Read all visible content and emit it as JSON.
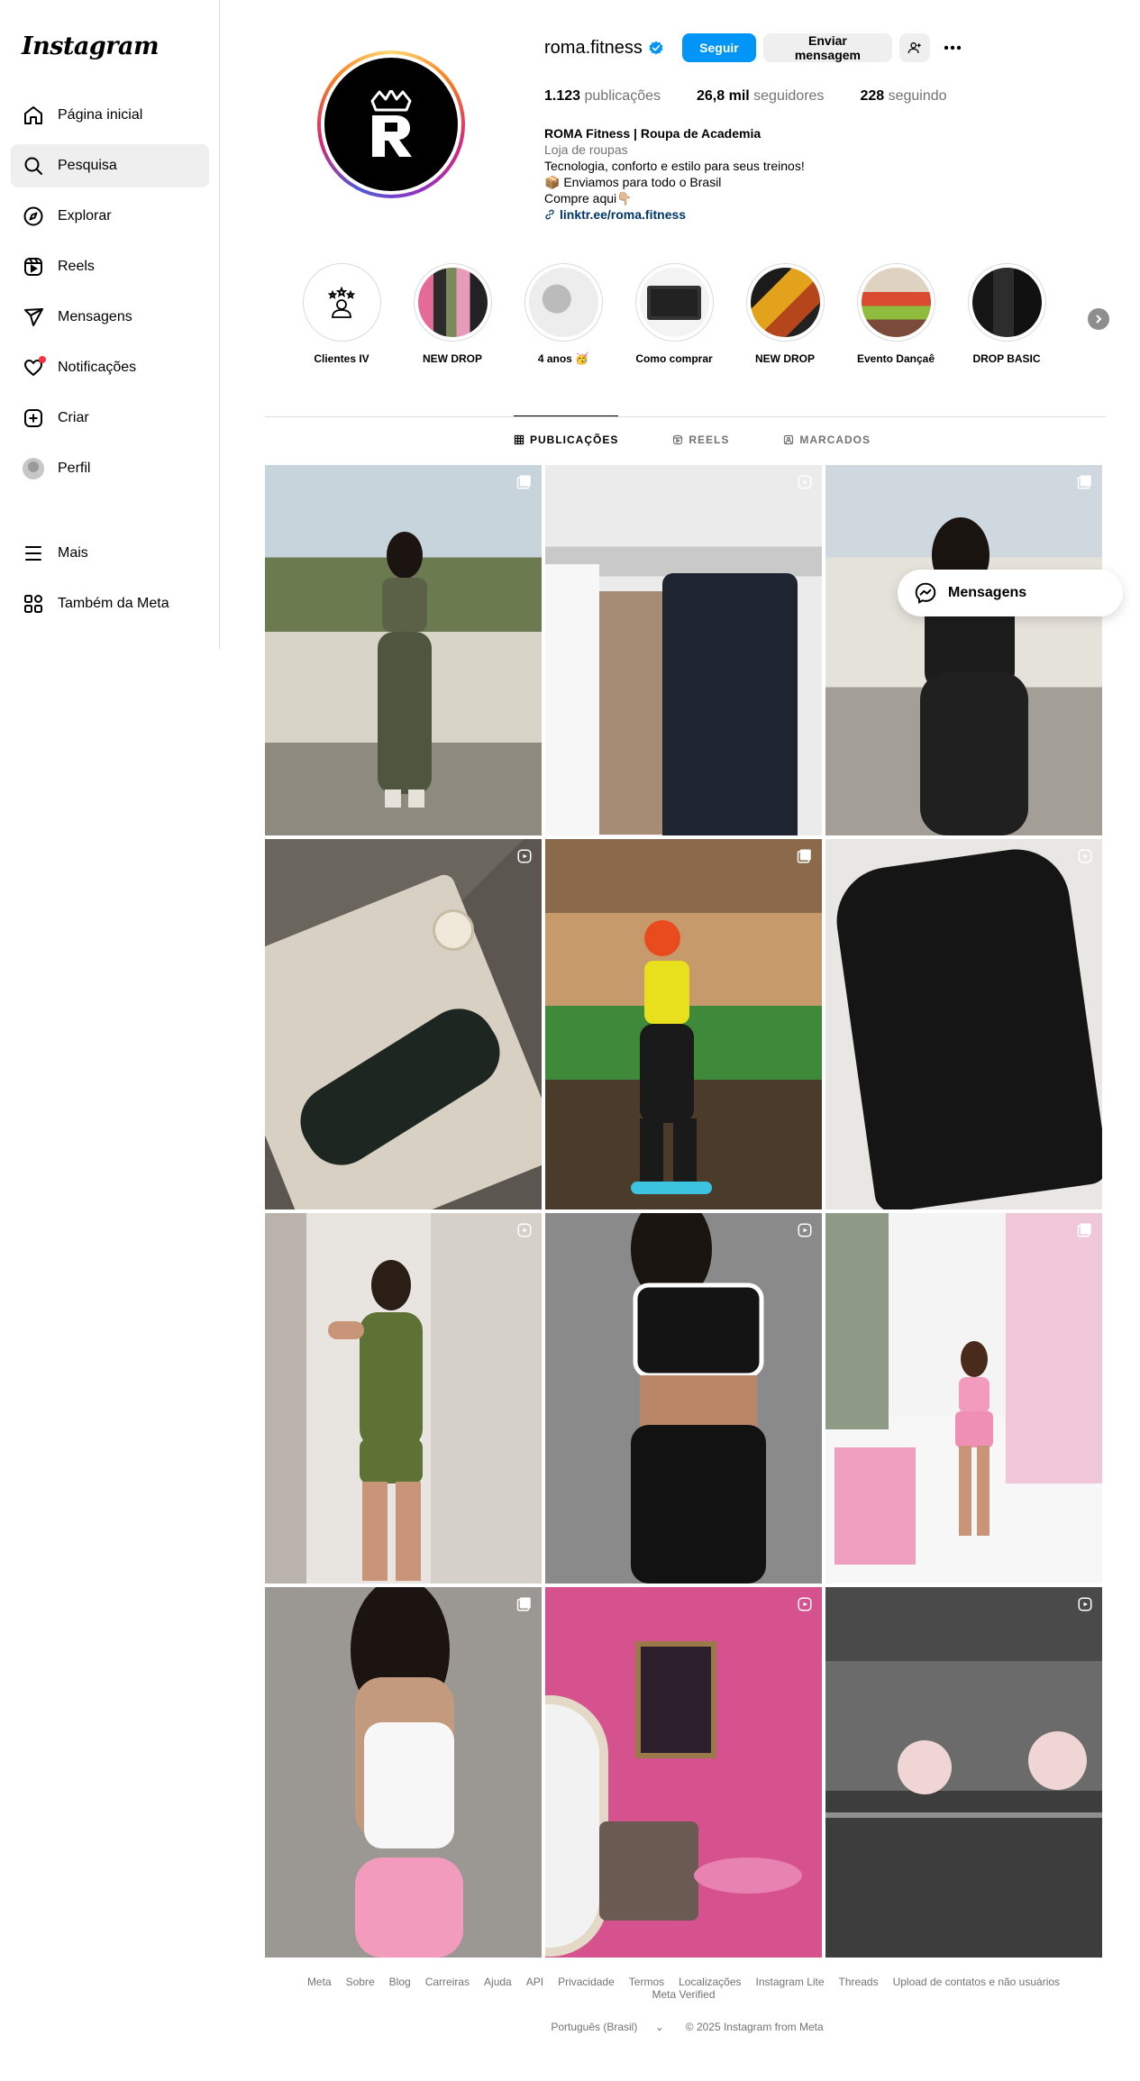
{
  "sidebar": {
    "logo": "Instagram",
    "items": [
      {
        "label": "Página inicial",
        "icon": "home-icon"
      },
      {
        "label": "Pesquisa",
        "icon": "search-icon"
      },
      {
        "label": "Explorar",
        "icon": "compass-icon"
      },
      {
        "label": "Reels",
        "icon": "reels-icon"
      },
      {
        "label": "Mensagens",
        "icon": "send-icon"
      },
      {
        "label": "Notificações",
        "icon": "heart-icon"
      },
      {
        "label": "Criar",
        "icon": "plus-square-icon"
      },
      {
        "label": "Perfil",
        "icon": "avatar"
      }
    ],
    "bottom": [
      {
        "label": "Mais",
        "icon": "menu-icon"
      },
      {
        "label": "Também da Meta",
        "icon": "meta-apps-icon"
      }
    ]
  },
  "profile": {
    "username": "roma.fitness",
    "follow_label": "Seguir",
    "message_label": "Enviar mensagem",
    "stats": {
      "posts_count": "1.123",
      "posts_label": "publicações",
      "followers_count": "26,8 mil",
      "followers_label": "seguidores",
      "following_count": "228",
      "following_label": "seguindo"
    },
    "bio": {
      "name": "ROMA Fitness | Roupa de Academia",
      "category": "Loja de roupas",
      "line1": "Tecnologia, conforto e estilo para seus treinos!",
      "line2": "📦 Enviamos para todo o Brasil",
      "line3": "Compre aqui👇🏼",
      "link": "linktr.ee/roma.fitness"
    }
  },
  "highlights": [
    {
      "label": "Clientes IV"
    },
    {
      "label": "NEW DROP"
    },
    {
      "label": "4 anos 🥳"
    },
    {
      "label": "Como comprar"
    },
    {
      "label": "NEW DROP"
    },
    {
      "label": "Evento Dançaê"
    },
    {
      "label": "DROP BASIC"
    }
  ],
  "tabs": [
    {
      "label": "PUBLICAÇÕES",
      "icon": "grid-icon",
      "active": true
    },
    {
      "label": "REELS",
      "icon": "reels-icon",
      "active": false
    },
    {
      "label": "MARCADOS",
      "icon": "tagged-icon",
      "active": false
    }
  ],
  "posts": [
    {
      "type": "carousel"
    },
    {
      "type": "reel"
    },
    {
      "type": "carousel"
    },
    {
      "type": "reel"
    },
    {
      "type": "carousel"
    },
    {
      "type": "reel"
    },
    {
      "type": "reel"
    },
    {
      "type": "reel"
    },
    {
      "type": "carousel"
    },
    {
      "type": "carousel"
    },
    {
      "type": "reel"
    },
    {
      "type": "reel"
    }
  ],
  "floating_messages": {
    "label": "Mensagens"
  },
  "footer": {
    "links": [
      "Meta",
      "Sobre",
      "Blog",
      "Carreiras",
      "Ajuda",
      "API",
      "Privacidade",
      "Termos",
      "Localizações",
      "Instagram Lite",
      "Threads",
      "Upload de contatos e não usuários",
      "Meta Verified"
    ],
    "language": "Português (Brasil)",
    "copyright": "© 2025 Instagram from Meta"
  },
  "colors": {
    "accent": "#0095f6",
    "link": "#00376b",
    "notification": "#ff3040"
  }
}
